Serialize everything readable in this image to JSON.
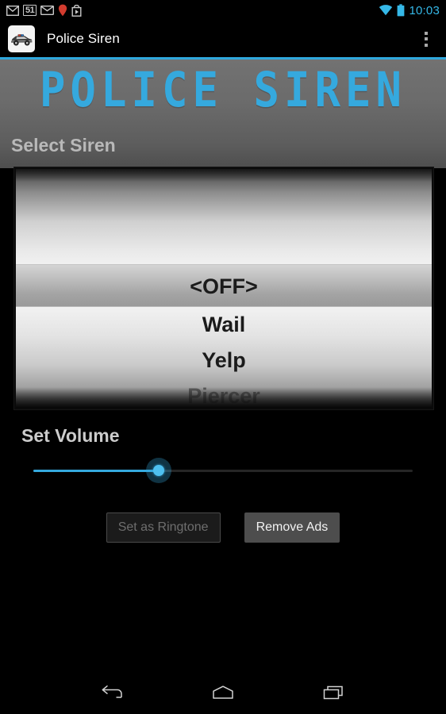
{
  "status_bar": {
    "left_icons": [
      {
        "name": "gmail-icon",
        "label": "M"
      },
      {
        "name": "notification-count-badge",
        "label": "51"
      },
      {
        "name": "email-icon",
        "label": ""
      },
      {
        "name": "location-pin-icon",
        "label": ""
      },
      {
        "name": "play-store-icon",
        "label": ""
      }
    ],
    "right_icons": [
      {
        "name": "wifi-icon",
        "label": ""
      },
      {
        "name": "battery-icon",
        "label": ""
      }
    ],
    "time": "10:03",
    "accent_color": "#35b8e8"
  },
  "action_bar": {
    "app_icon_name": "police-car-app-icon",
    "title": "Police Siren",
    "overflow_label": "More options",
    "accent_line_color": "#2fa8dd"
  },
  "header": {
    "logo_text": "POLICE SIREN",
    "logo_color": "#35a9de"
  },
  "main": {
    "select_siren_label": "Select Siren",
    "picker": {
      "selected_value": "<OFF>",
      "rows": [
        {
          "label": "<OFF>",
          "state": "selected"
        },
        {
          "label": "Wail",
          "state": "normal"
        },
        {
          "label": "Yelp",
          "state": "normal"
        },
        {
          "label": "Piercer",
          "state": "faded"
        }
      ]
    },
    "volume_label": "Set Volume",
    "slider": {
      "value_percent": 33,
      "fill_color": "#35a9de",
      "track_color": "#262626"
    },
    "buttons": [
      {
        "label": "Set as Ringtone",
        "state": "disabled",
        "name": "set-as-ringtone-button"
      },
      {
        "label": "Remove Ads",
        "state": "enabled",
        "name": "remove-ads-button"
      }
    ]
  },
  "nav_bar": {
    "back_label": "Back",
    "home_label": "Home",
    "recents_label": "Recent apps"
  }
}
